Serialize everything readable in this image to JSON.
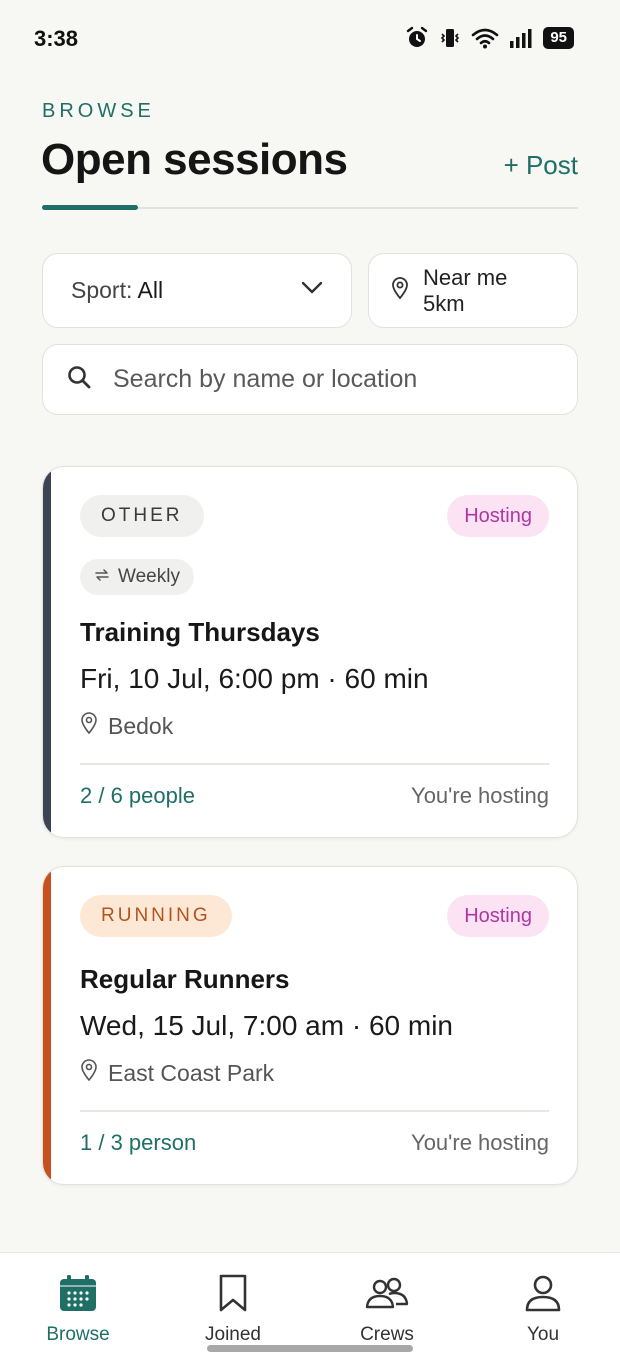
{
  "status_bar": {
    "time": "3:38",
    "battery": "95"
  },
  "header": {
    "eyebrow": "BROWSE",
    "title": "Open sessions",
    "post_label": "+ Post"
  },
  "filters": {
    "sport_prefix": "Sport:",
    "sport_value": "All",
    "near_me_label": "Near me 5km",
    "search_placeholder": "Search by name or location"
  },
  "sessions": [
    {
      "sport": "OTHER",
      "badge": "Hosting",
      "repeat": "Weekly",
      "title": "Training Thursdays",
      "when": "Fri, 10 Jul, 6:00 pm · 60 min",
      "location": "Bedok",
      "count": "2 / 6 people",
      "role": "You're hosting",
      "stripe_color": "#3b4454",
      "chip_bg": "#f0f0ee",
      "chip_fg": "#3a3a3a"
    },
    {
      "sport": "RUNNING",
      "badge": "Hosting",
      "title": "Regular Runners",
      "when": "Wed, 15 Jul, 7:00 am · 60 min",
      "location": "East Coast Park",
      "count": "1 / 3 person",
      "role": "You're hosting",
      "stripe_color": "#c7501f",
      "chip_bg": "#fde8d6",
      "chip_fg": "#b3541e"
    }
  ],
  "nav": {
    "items": [
      {
        "label": "Browse",
        "icon": "calendar-icon",
        "active": true
      },
      {
        "label": "Joined",
        "icon": "bookmark-icon",
        "active": false
      },
      {
        "label": "Crews",
        "icon": "people-icon",
        "active": false
      },
      {
        "label": "You",
        "icon": "person-icon",
        "active": false
      }
    ]
  },
  "colors": {
    "accent": "#1f6f66",
    "hosting_bg": "#fbe3f3",
    "hosting_fg": "#b036a5",
    "background": "#f7f7f4"
  }
}
